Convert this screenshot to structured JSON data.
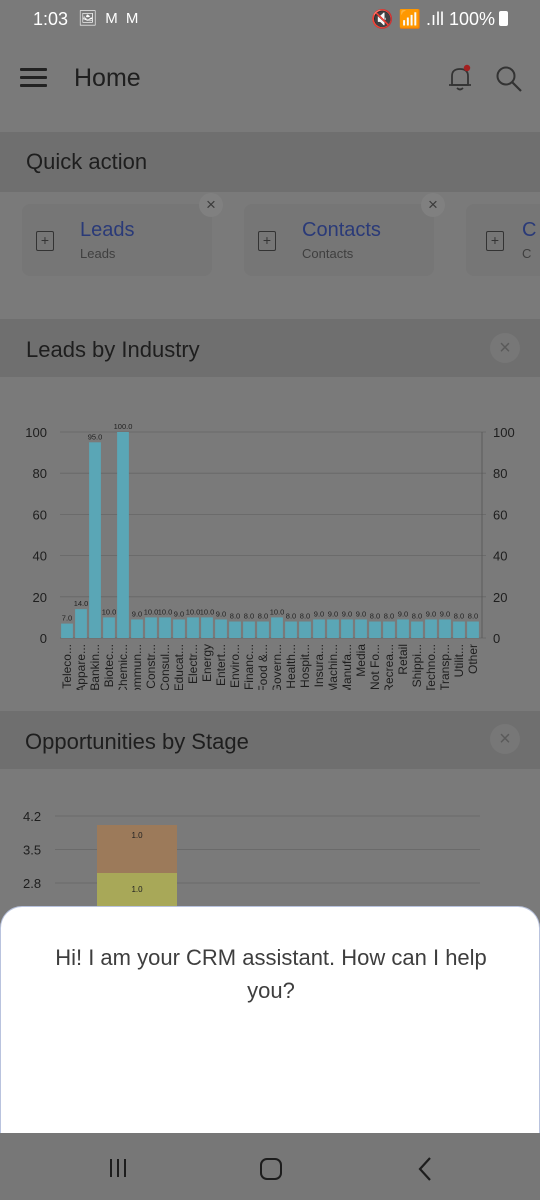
{
  "status_bar": {
    "time": "1:03",
    "notif_icons": "🖼 M M",
    "right": "🔇 📶 .ıll 100%"
  },
  "header": {
    "title": "Home",
    "icons": [
      "bell-icon",
      "search-icon"
    ]
  },
  "quick_action": {
    "title": "Quick action",
    "cards": [
      {
        "label": "Leads",
        "sub": "Leads"
      },
      {
        "label": "Contacts",
        "sub": "Contacts"
      },
      {
        "label": "C",
        "sub": "C"
      }
    ],
    "close_glyph": "×"
  },
  "leads_by_industry": {
    "title": "Leads by Industry",
    "close_glyph": "×",
    "chart_data": {
      "type": "bar",
      "categories": [
        "Teleco...",
        "Appare...",
        "Bankin...",
        "Biotec...",
        "Chemic...",
        "Commun...",
        "Constr...",
        "Consul...",
        "Educat...",
        "Electr...",
        "Energy",
        "Entert...",
        "Enviro...",
        "Financ...",
        "Food &...",
        "Govern...",
        "Health...",
        "Hospit...",
        "Insura...",
        "Machin...",
        "Manufa...",
        "Media",
        "Not Fo...",
        "Recrea...",
        "Retail",
        "Shippi...",
        "Techno...",
        "Transp...",
        "Utilit...",
        "Other"
      ],
      "values": [
        7.0,
        14.0,
        95.0,
        10.0,
        100.0,
        9.0,
        10.0,
        10.0,
        9.0,
        10.0,
        10.0,
        9.0,
        8.0,
        8.0,
        8.0,
        10.0,
        8.0,
        8.0,
        9.0,
        9.0,
        9.0,
        9.0,
        8.0,
        8.0,
        9.0,
        8.0,
        9.0,
        9.0,
        8.0,
        8.0
      ],
      "y_ticks": [
        "0",
        "20",
        "40",
        "60",
        "80",
        "100"
      ],
      "ylim": [
        0,
        100
      ],
      "color": "#5aa6b6",
      "grid": true
    }
  },
  "opportunities_by_stage": {
    "title": "Opportunities by Stage",
    "close_glyph": "×",
    "chart_data": {
      "type": "bar",
      "y_ticks": [
        "2.8",
        "3.5",
        "4.2"
      ],
      "stack_labels": [
        "1.0",
        "1.0"
      ],
      "colors": [
        "#9c7a5a",
        "#a8a858"
      ]
    }
  },
  "assistant": {
    "message": "Hi! I am your CRM assistant. How can I help you?"
  }
}
